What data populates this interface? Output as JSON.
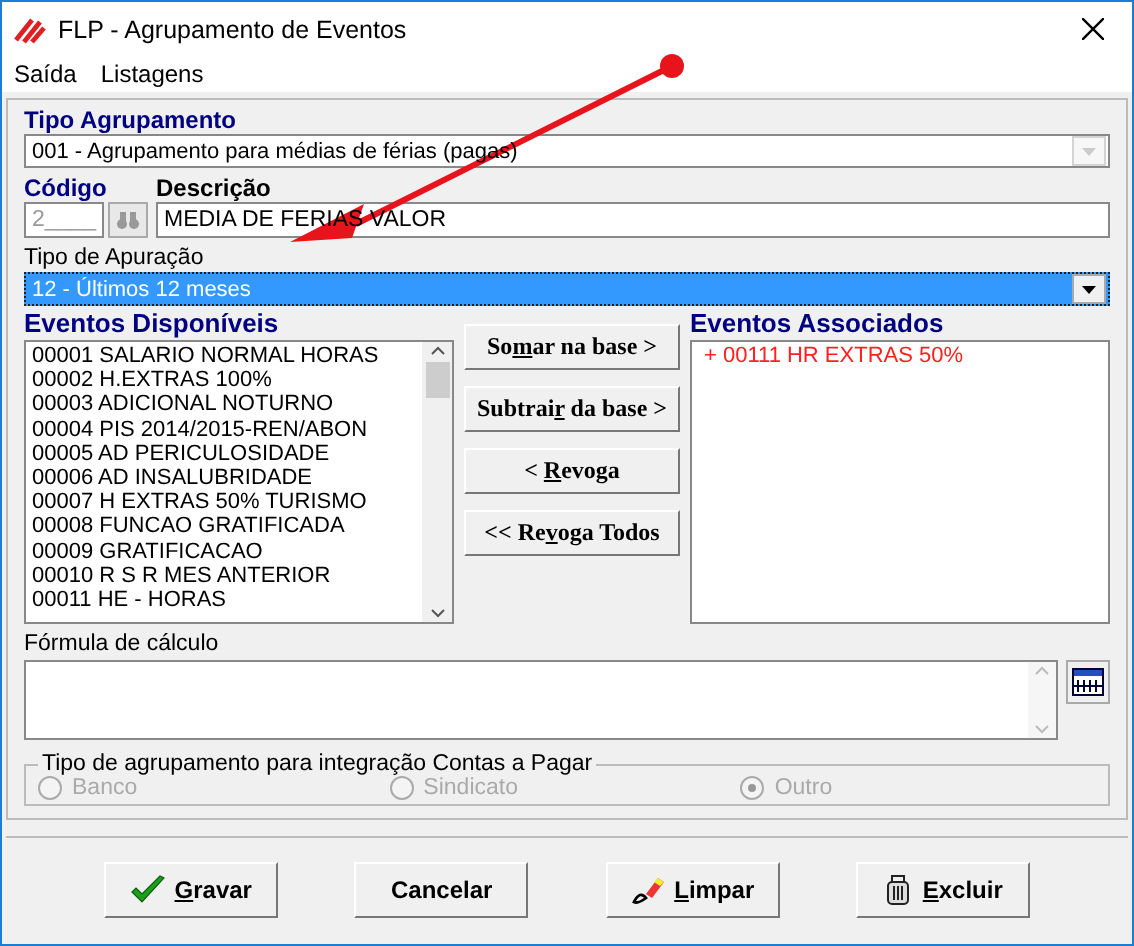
{
  "window": {
    "title": "FLP - Agrupamento de Eventos"
  },
  "menu": [
    "Saída",
    "Listagens"
  ],
  "tipo_agrupamento": {
    "label": "Tipo Agrupamento",
    "value": "001 - Agrupamento para médias de férias (pagas)",
    "disabled": true
  },
  "codigo": {
    "label": "Código",
    "value": "2____",
    "disabled": true
  },
  "descricao": {
    "label": "Descrição",
    "value": "MEDIA DE FERIAS VALOR"
  },
  "tipo_apuracao": {
    "label": "Tipo de Apuração",
    "value": "12 - Últimos 12 meses",
    "selected": true
  },
  "disponiveis": {
    "label": "Eventos Disponíveis",
    "items": [
      "00001 SALARIO NORMAL HORAS",
      "00002 H.EXTRAS 100%",
      "00003 ADICIONAL NOTURNO",
      "00004 PIS 2014/2015-REN/ABON",
      "00005 AD PERICULOSIDADE",
      "00006 AD INSALUBRIDADE",
      "00007 H EXTRAS 50% TURISMO",
      "00008 FUNCAO GRATIFICADA",
      "00009 GRATIFICACAO",
      "00010 R S R MES ANTERIOR",
      "00011 HE - HORAS"
    ]
  },
  "actions": [
    {
      "before": "So",
      "key": "m",
      "after": "ar  na base >"
    },
    {
      "before": "Subtrai",
      "key": "r",
      "after": " da base >"
    },
    {
      "before": "< ",
      "key": "R",
      "after": "evoga"
    },
    {
      "before": "<< Re",
      "key": "v",
      "after": "oga Todos"
    }
  ],
  "associados": {
    "label": "Eventos Associados",
    "items": [
      {
        "text": "+ 00111 HR EXTRAS 50%",
        "kind": "sum"
      }
    ]
  },
  "formula": {
    "label": "Fórmula de cálculo"
  },
  "integracao": {
    "label": "Tipo de agrupamento para integração Contas a Pagar",
    "disabled": true,
    "options": [
      {
        "label": "Banco",
        "selected": false
      },
      {
        "label": "Sindicato",
        "selected": false
      },
      {
        "label": "Outro",
        "selected": true
      }
    ]
  },
  "buttons": [
    {
      "kind": "save",
      "key": "G",
      "after": "ravar"
    },
    {
      "kind": "cancel",
      "after": "Cancelar"
    },
    {
      "kind": "clear",
      "key": "L",
      "after": "impar"
    },
    {
      "kind": "delete",
      "key": "E",
      "after": "xcluir"
    }
  ]
}
